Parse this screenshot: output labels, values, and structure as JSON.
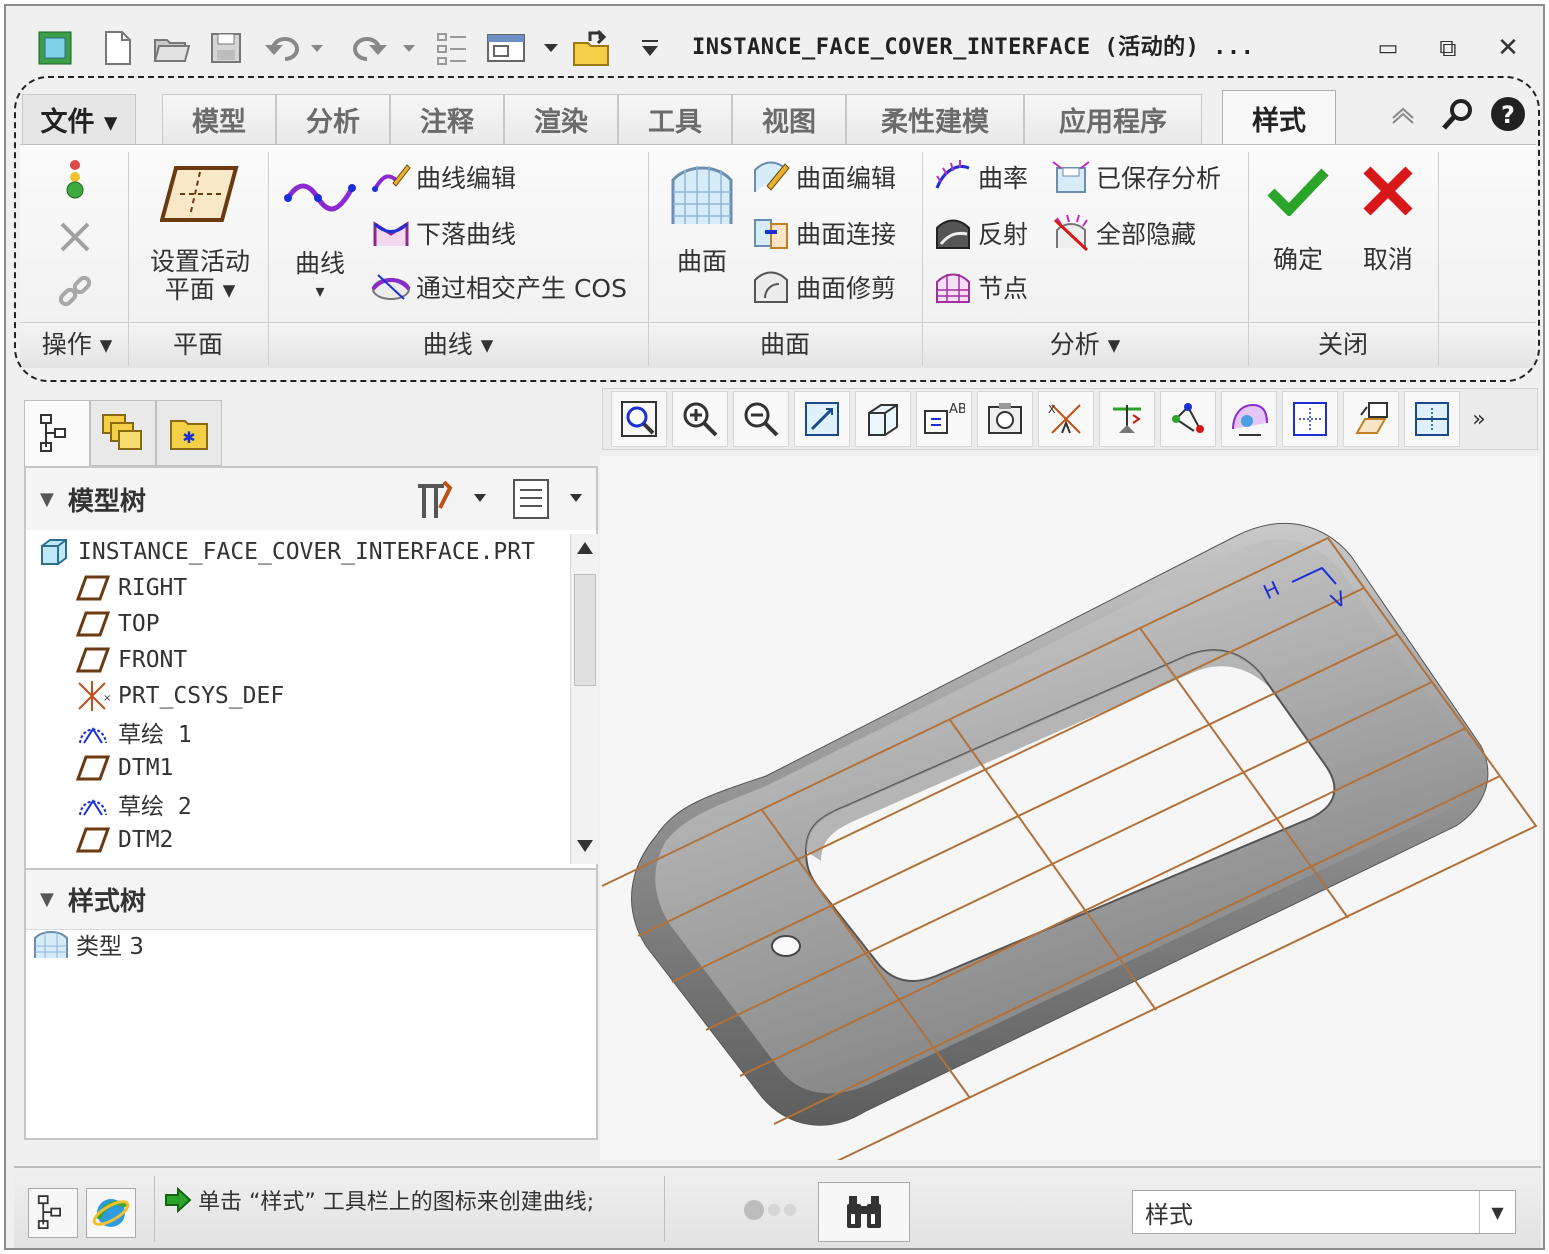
{
  "window": {
    "title": "INSTANCE_FACE_COVER_INTERFACE (活动的) ...",
    "minimize": "▭",
    "maximize": "⧉",
    "close": "✕"
  },
  "ribbon": {
    "tabs": [
      {
        "label": "文件 ▾"
      },
      {
        "label": "模型"
      },
      {
        "label": "分析"
      },
      {
        "label": "注释"
      },
      {
        "label": "渲染"
      },
      {
        "label": "工具"
      },
      {
        "label": "视图"
      },
      {
        "label": "柔性建模"
      },
      {
        "label": "应用程序"
      },
      {
        "label": "样式"
      }
    ],
    "groups": {
      "operations": "操作 ▾",
      "plane": "平面",
      "curves": "曲线 ▾",
      "surfaces": "曲面",
      "analysis": "分析 ▾",
      "close": "关闭"
    },
    "buttons": {
      "set_active_plane_1": "设置活动",
      "set_active_plane_2": "平面 ▾",
      "curve": "曲线",
      "curve_arrow": "▾",
      "curve_edit": "曲线编辑",
      "drop_curve": "下落曲线",
      "cos": "通过相交产生 COS",
      "surface": "曲面",
      "surface_edit": "曲面编辑",
      "surface_connect": "曲面连接",
      "surface_trim": "曲面修剪",
      "curvature": "曲率",
      "reflection": "反射",
      "node": "节点",
      "saved_analysis": "已保存分析",
      "hide_all": "全部隐藏",
      "ok": "确定",
      "cancel": "取消"
    }
  },
  "navigator": {
    "model_tree_title": "模型树",
    "style_tree_title": "样式树",
    "tree_items": [
      {
        "label": "INSTANCE_FACE_COVER_INTERFACE.PRT",
        "icon": "part-icon"
      },
      {
        "label": "RIGHT",
        "icon": "datum-plane-icon"
      },
      {
        "label": "TOP",
        "icon": "datum-plane-icon"
      },
      {
        "label": "FRONT",
        "icon": "datum-plane-icon"
      },
      {
        "label": "PRT_CSYS_DEF",
        "icon": "csys-icon"
      },
      {
        "label": "草绘 1",
        "icon": "sketch-icon"
      },
      {
        "label": "DTM1",
        "icon": "datum-plane-icon"
      },
      {
        "label": "草绘 2",
        "icon": "sketch-icon"
      },
      {
        "label": "DTM2",
        "icon": "datum-plane-icon"
      }
    ],
    "style_items": [
      {
        "label": "类型 3",
        "icon": "style-type-icon"
      }
    ]
  },
  "viewport": {
    "csys_label": "H",
    "csys_label2": "V"
  },
  "status": {
    "message": "单击 “样式” 工具栏上的图标来创建曲线;",
    "filter_value": "样式"
  },
  "colors": {
    "accent_green": "#2aa52a",
    "cancel_red": "#d81818",
    "datum_brown": "#b0723a",
    "part_gray": "#9a9a9a",
    "csys_blue": "#1a2fd6"
  }
}
